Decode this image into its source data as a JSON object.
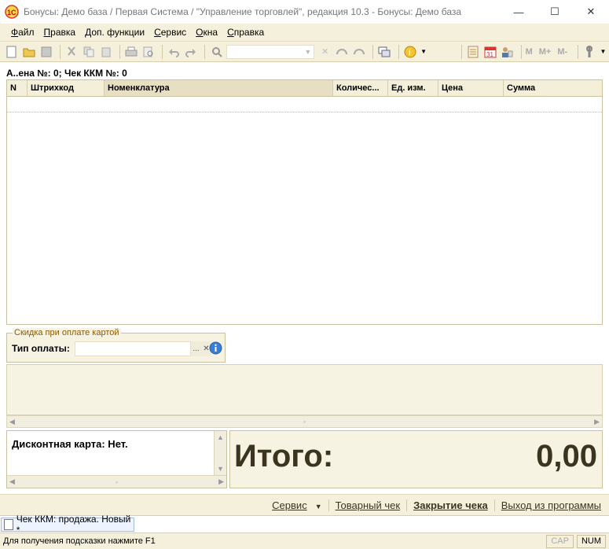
{
  "window": {
    "title": "Бонусы: Демо база / Первая Система / \"Управление торговлей\", редакция 10.3 - Бонусы: Демо база",
    "minimize": "—",
    "maximize": "☐",
    "close": "✕"
  },
  "menu": [
    "Файл",
    "Правка",
    "Доп. функции",
    "Сервис",
    "Окна",
    "Справка"
  ],
  "toolbar": {
    "icons": [
      "new-document",
      "open-folder",
      "save",
      "cut",
      "copy",
      "paste",
      "print",
      "print-preview",
      "undo",
      "redo",
      "search",
      "search-combo",
      "prev-found",
      "next-found",
      "windows",
      "info",
      "calendar-sheet",
      "calendar",
      "users",
      "m-labels",
      "settings"
    ],
    "m": "M",
    "m_plus": "M+",
    "m_minus": "M-",
    "calendar_day": "31"
  },
  "doc_header": "А..ена №: 0; Чек ККМ №: 0",
  "grid": {
    "columns": [
      "N",
      "Штрихкод",
      "Номенклатура",
      "Количес...",
      "Ед. изм.",
      "Цена",
      "Сумма"
    ]
  },
  "discount_group": {
    "caption": "Скидка при оплате картой",
    "payment_type_label": "Тип оплаты:",
    "payment_type_value": "",
    "select_button": "...",
    "clear_button": "✕"
  },
  "discount_card": {
    "text": "Дисконтная карта: Нет."
  },
  "total": {
    "label": "Итого:",
    "value": "0,00"
  },
  "commands": {
    "service": "Сервис",
    "goods_receipt": "Товарный чек",
    "close_receipt": "Закрытие чека",
    "exit": "Выход из программы"
  },
  "window_tab": "Чек ККМ: продажа. Новый *",
  "status": {
    "hint": "Для получения подсказки нажмите F1",
    "cap": "CAP",
    "num": "NUM"
  }
}
